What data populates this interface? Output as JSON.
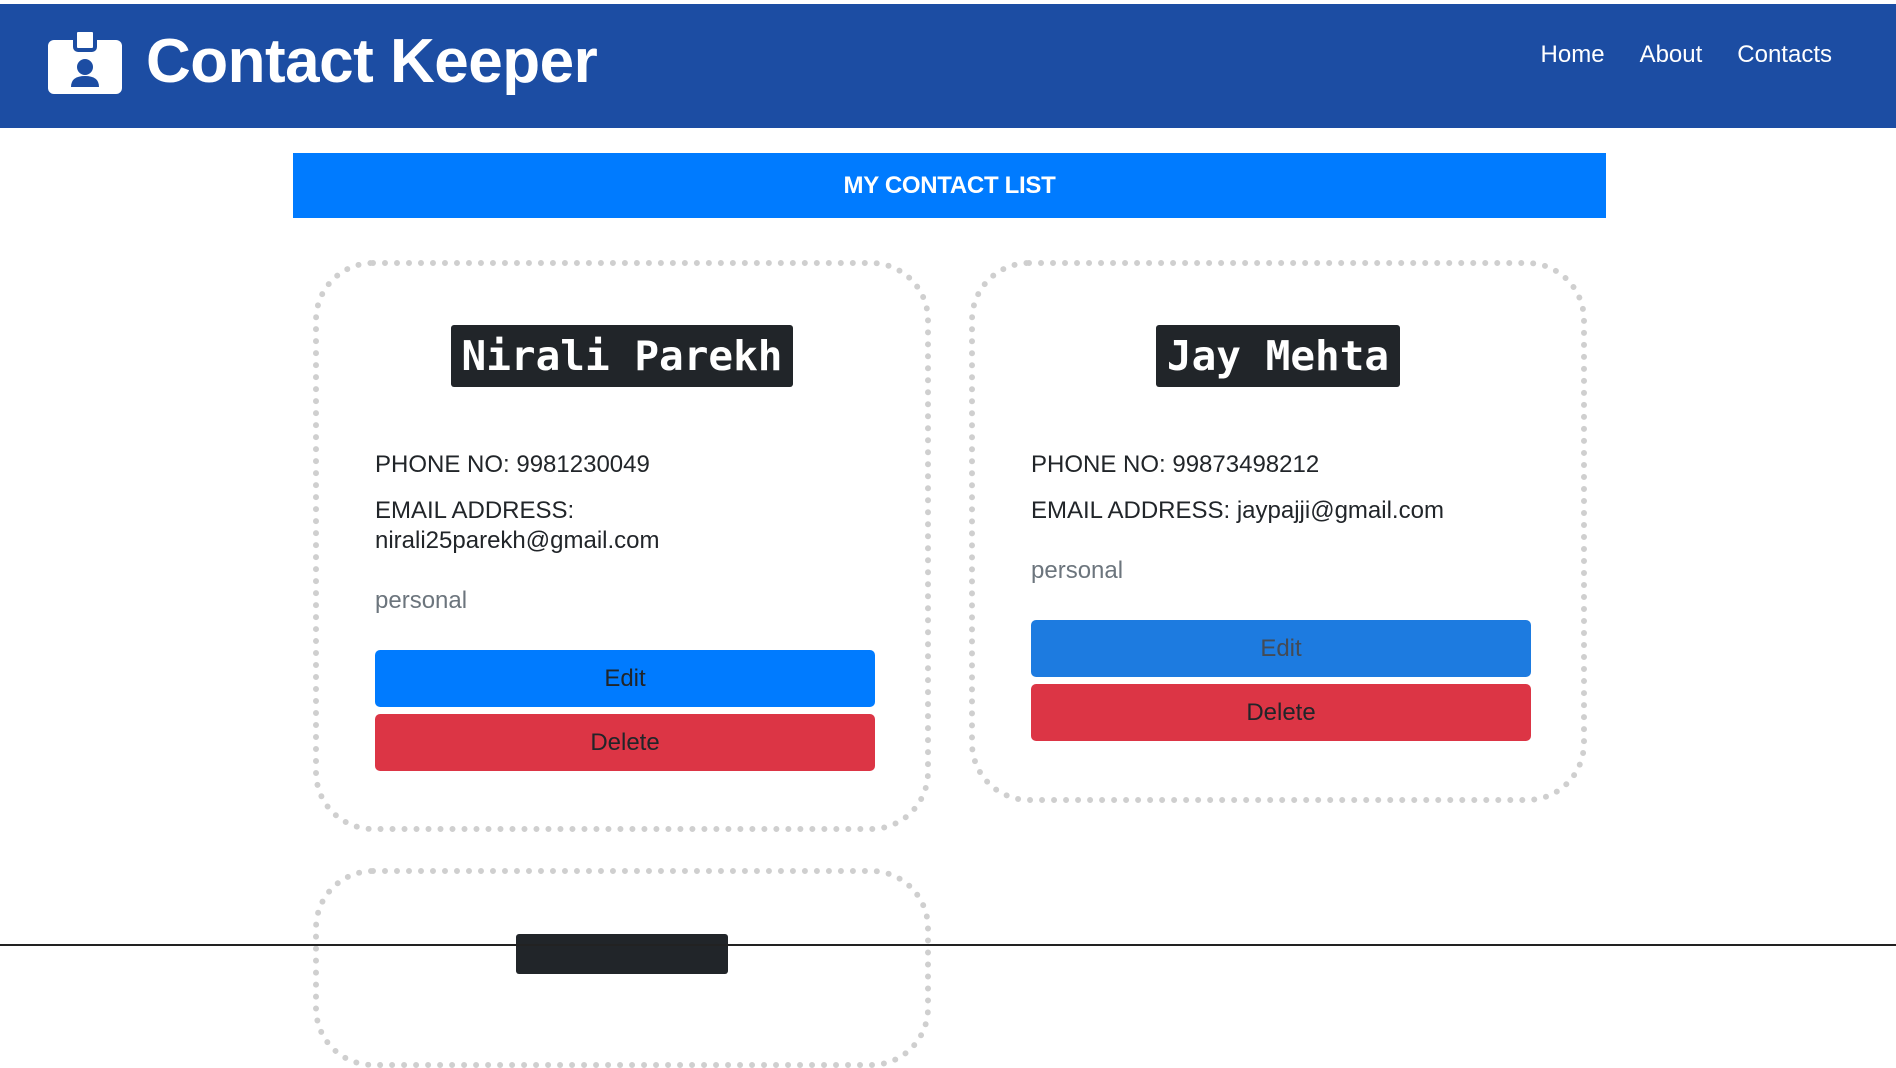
{
  "app": {
    "title": "Contact Keeper",
    "brand_icon": "id-badge-icon"
  },
  "nav": {
    "items": [
      {
        "label": "Home"
      },
      {
        "label": "About"
      },
      {
        "label": "Contacts"
      }
    ]
  },
  "list_header": {
    "label": "MY CONTACT LIST"
  },
  "contacts": [
    {
      "name": "Nirali Parekh",
      "phone_label": "PHONE NO:",
      "phone": "9981230049",
      "email_label": "EMAIL ADDRESS:",
      "email": "nirali25parekh@gmail.com",
      "type": "personal",
      "edit_label": "Edit",
      "delete_label": "Delete"
    },
    {
      "name": "Jay Mehta",
      "phone_label": "PHONE NO:",
      "phone": "99873498212",
      "email_label": "EMAIL ADDRESS:",
      "email": "jaypajji@gmail.com",
      "type": "personal",
      "edit_label": "Edit",
      "delete_label": "Delete"
    }
  ],
  "colors": {
    "navbar": "#1c4da3",
    "header_bar": "#007bff",
    "edit_button": "#007bff",
    "delete_button": "#dc3545",
    "name_badge": "#212529"
  }
}
